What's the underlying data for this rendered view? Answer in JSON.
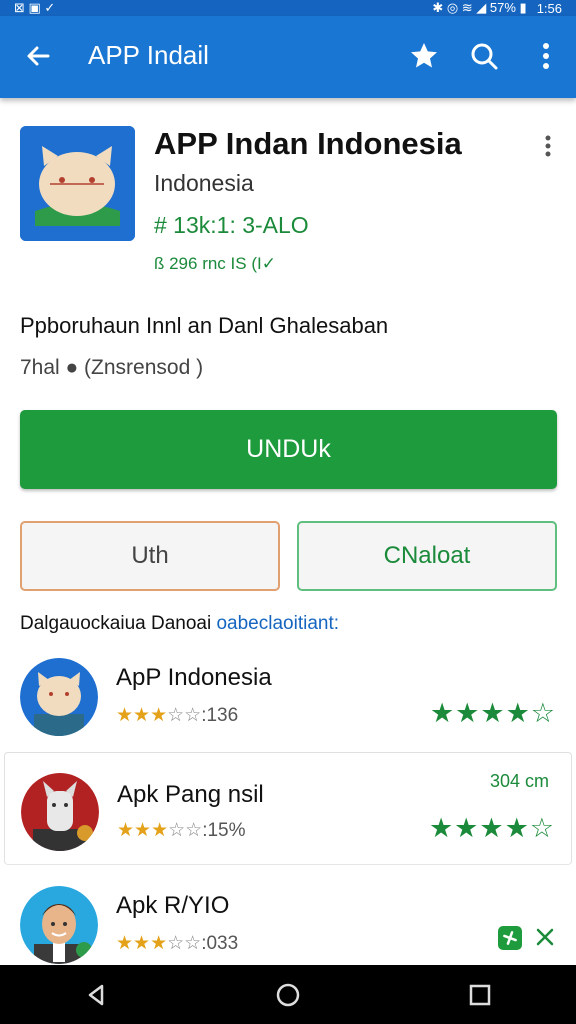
{
  "statusbar": {
    "left_icons": "⊠ ▣ ✓",
    "right": "✱ ◎ ≋ ◢ 57% ▮",
    "time": "1:56"
  },
  "appbar": {
    "title": "APP Indail",
    "back_icon": "arrow-left-icon",
    "star_icon": "star-icon",
    "search_icon": "search-icon",
    "more_icon": "more-vert-icon"
  },
  "app": {
    "name": "APP Indan Indonesia",
    "developer": "Indonesia",
    "meta": "# 13k:1: 3-ALO",
    "meta2": "ß 296 rnc IS (I✓",
    "description": "Ppboruhaun Innl an Danl Ghalesaban",
    "tag": "7hal ● (Znsrensod )"
  },
  "buttons": {
    "install": "UNDUk",
    "secondary_left": "Uth",
    "secondary_right": "CNaloat"
  },
  "section": {
    "title": "Dalgauockaiua Danoai ",
    "link": "oabeclaoitiant:"
  },
  "related": [
    {
      "name": "ApP Indonesia",
      "stars": "★★★",
      "rest": "☆☆",
      "count": ":136",
      "big_stars": "★★★★",
      "big_empty": "☆",
      "size": ""
    },
    {
      "name": "Apk Pang nsil",
      "stars": "★★★",
      "rest": "☆☆",
      "count": ":15%",
      "big_stars": "★★★★",
      "big_empty": "☆",
      "size": "304 cm"
    },
    {
      "name": "Apk R/YIO",
      "stars": "★★★",
      "rest": "☆☆",
      "count": ":033",
      "big_stars": "",
      "big_empty": "",
      "size": ""
    }
  ],
  "colors": {
    "appbar": "#1976d2",
    "install": "#1e9b3c",
    "accent_green": "#1b8a3a",
    "link": "#1565c0"
  },
  "nav": {
    "back": "nav-back-icon",
    "home": "nav-home-icon",
    "recents": "nav-recents-icon"
  }
}
